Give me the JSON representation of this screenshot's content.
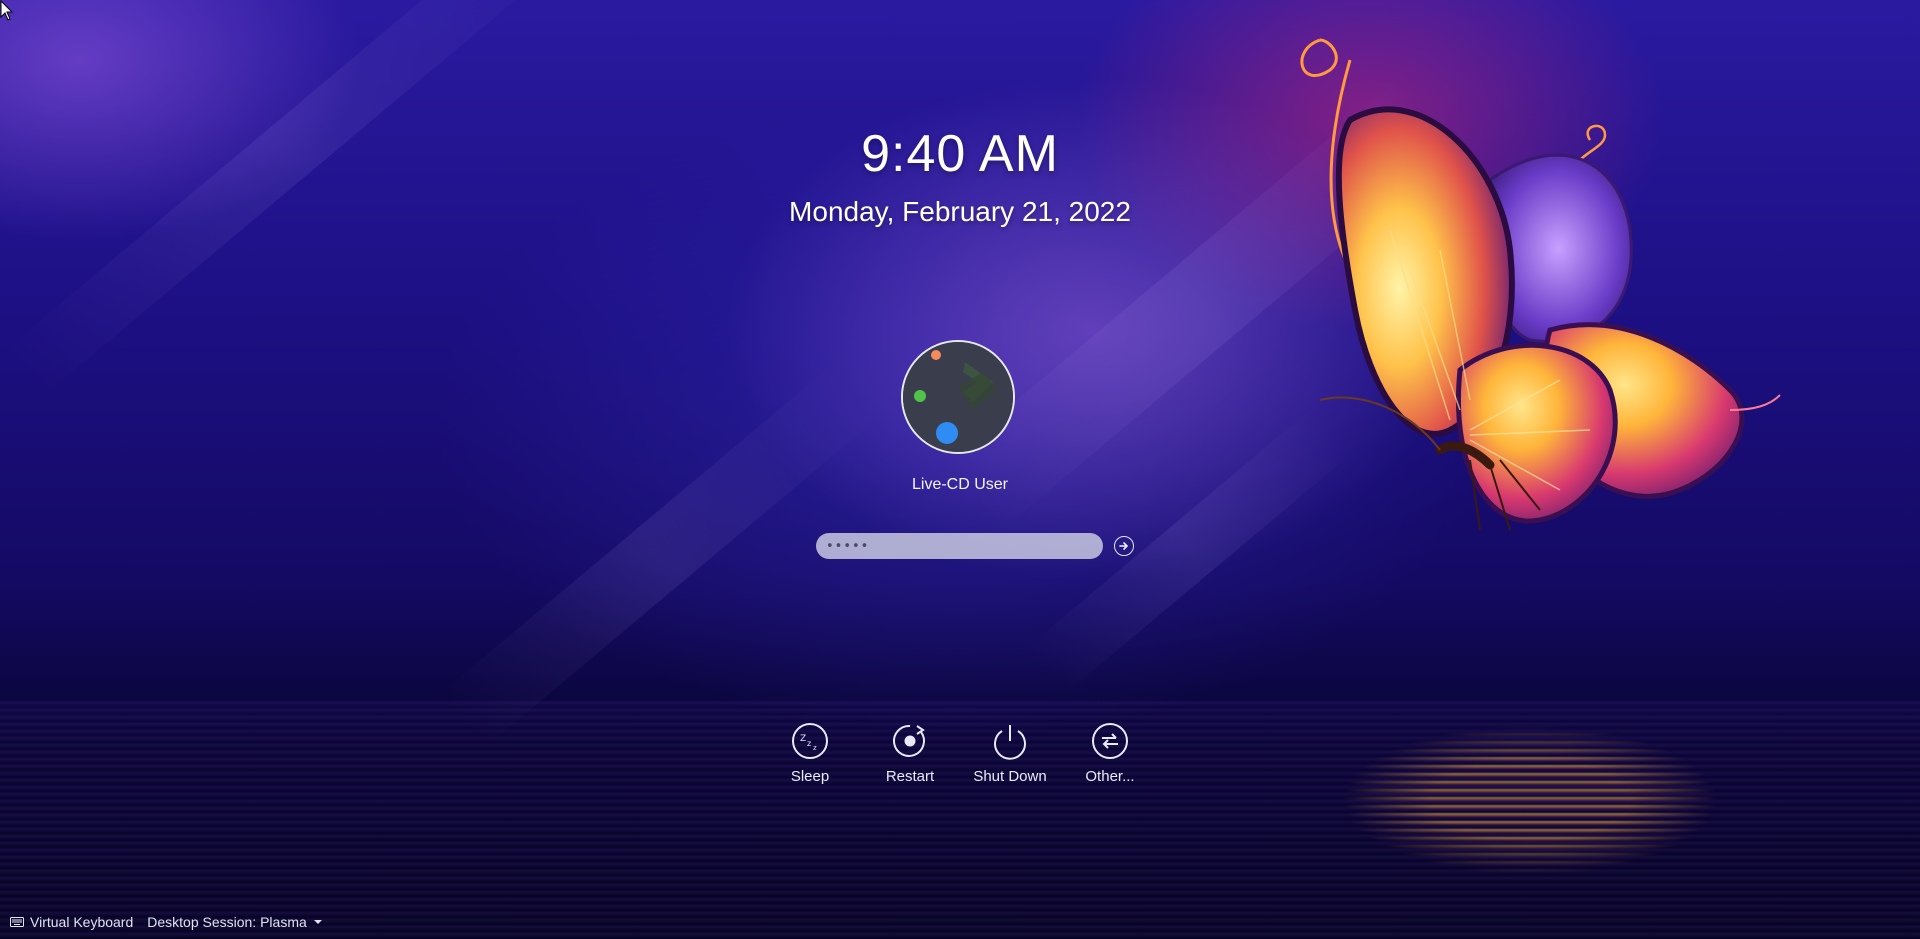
{
  "lock_screen": {
    "time": "9:40 AM",
    "date": "Monday, February 21, 2022",
    "user": {
      "name": "Live-CD User"
    },
    "password": {
      "value": "•••••"
    },
    "login_button": {
      "icon": "arrow-right-icon"
    }
  },
  "actions": [
    {
      "label": "Sleep",
      "icon": "sleep-icon"
    },
    {
      "label": "Restart",
      "icon": "restart-icon"
    },
    {
      "label": "Shut Down",
      "icon": "power-icon"
    },
    {
      "label": "Other...",
      "icon": "switch-user-icon"
    }
  ],
  "footer": {
    "virtual_keyboard": "Virtual Keyboard",
    "session": "Desktop Session: Plasma"
  },
  "colors": {
    "background_top": "#2a1aa0",
    "background_bottom": "#05031e",
    "accent_magenta": "#d2287a",
    "wing_gold": "#ffc24a",
    "text": "#ffffff"
  }
}
